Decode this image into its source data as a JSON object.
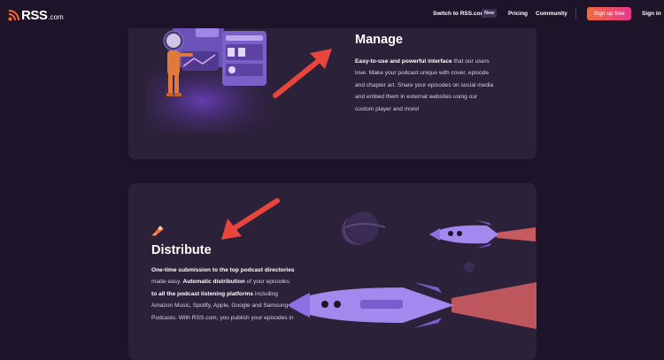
{
  "nav": {
    "logo_text": "RSS",
    "logo_tld": ".com",
    "switch_label": "Switch to RSS.com",
    "new_badge": "New",
    "pricing": "Pricing",
    "community": "Community",
    "signup": "Sign up free",
    "signin": "Sign in"
  },
  "manage": {
    "title": "Manage",
    "lines": [
      {
        "bold": "Easy-to-use and powerful interface",
        "rest": " that our users"
      },
      {
        "bold": "",
        "rest": "love. Make your podcast unique with cover, episode"
      },
      {
        "bold": "",
        "rest": "and chapter art. Share your episodes on social media"
      },
      {
        "bold": "",
        "rest": "and embed them in external websites using our"
      },
      {
        "bold": "",
        "rest": "custom player and more!"
      }
    ]
  },
  "distribute": {
    "title": "Distribute",
    "lines": [
      {
        "pre": "",
        "bold": "One-time submission to the top podcast directories",
        "post": ""
      },
      {
        "pre": "made easy. ",
        "bold": "Automatic distribution",
        "post": " of your episodes"
      },
      {
        "pre": "",
        "bold": "to all the podcast listening platforms",
        "post": " including"
      },
      {
        "pre": "",
        "bold": "",
        "post": "Amazon Music, Spotify, Apple, Google and Samsung"
      },
      {
        "pre": "",
        "bold": "",
        "post": "Podcasts. With RSS.com, you publish your episodes in"
      }
    ]
  },
  "colors": {
    "page_bg": "#1d1429",
    "card_bg": "#2b2139",
    "accent_orange": "#f26b3a",
    "accent_pink": "#e8378f",
    "arrow_red": "#e8453c",
    "illustration_purple": "#8e6ee0"
  }
}
